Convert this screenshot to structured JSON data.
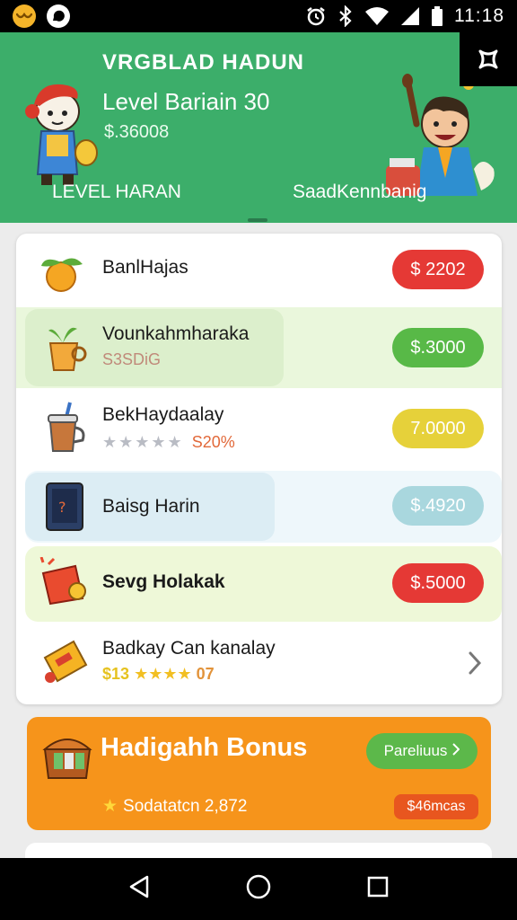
{
  "status_bar": {
    "time": "11:18",
    "left_icons": [
      "app-notification-icon",
      "messenger-icon"
    ],
    "right_icons": [
      "alarm-icon",
      "bluetooth-icon",
      "wifi-icon",
      "signal-icon",
      "battery-icon"
    ]
  },
  "header": {
    "title": "VRGBLAD HADUN",
    "level": "Level Bariain 30",
    "balance": "$.36008",
    "tabs": [
      {
        "label": "LEVEL HARAN"
      },
      {
        "label": "SaadKennbanig"
      }
    ],
    "bg_color": "#3cae6a"
  },
  "items": [
    {
      "name": "BanlHajas",
      "subtitle": "",
      "price": "$ 2202",
      "price_color": "#e53935",
      "icon": "orange-fruit-icon"
    },
    {
      "name": "Vounkahmharaka",
      "subtitle": "S3SDiG",
      "price": "$.3000",
      "price_color": "#58b947",
      "icon": "potted-plant-icon"
    },
    {
      "name": "BekHaydaalay",
      "stars": "★★★★★",
      "subtitle": "S20%",
      "price": "7.0000",
      "price_color": "#e6d13a",
      "icon": "drink-cup-icon"
    },
    {
      "name": "Baisg Harin",
      "subtitle": "",
      "price": "$.4920",
      "price_color": "#a9d7de",
      "icon": "tablet-icon"
    },
    {
      "name": "Sevg Holakak",
      "subtitle": "",
      "price": "$.5000",
      "price_color": "#e53935",
      "icon": "firework-ticket-icon"
    },
    {
      "name": "Badkay Can kanalay",
      "subtitle_prefix": "$13",
      "stars": "★★★★",
      "subtitle_suffix": "07",
      "icon": "golden-ticket-icon",
      "action": "chevron-right-icon"
    }
  ],
  "bonus": {
    "title": "Hadigahh Bonus",
    "button_label": "Pareliuus",
    "subtitle": "Sodatatcn 2,872",
    "badge": "$46mcas",
    "icon": "treasure-chest-icon",
    "bg_color": "#f6941b"
  },
  "nav_bar": {
    "icons": [
      "back-icon",
      "home-icon",
      "recents-icon"
    ]
  }
}
